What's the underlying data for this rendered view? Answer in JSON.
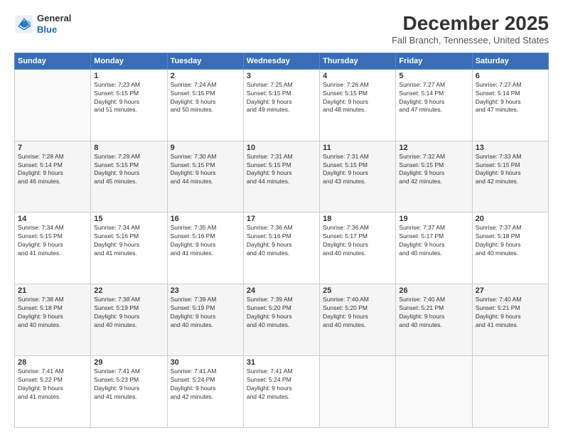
{
  "logo": {
    "line1": "General",
    "line2": "Blue"
  },
  "title": "December 2025",
  "subtitle": "Fall Branch, Tennessee, United States",
  "days_header": [
    "Sunday",
    "Monday",
    "Tuesday",
    "Wednesday",
    "Thursday",
    "Friday",
    "Saturday"
  ],
  "weeks": [
    [
      {
        "num": "",
        "info": ""
      },
      {
        "num": "1",
        "info": "Sunrise: 7:23 AM\nSunset: 5:15 PM\nDaylight: 9 hours\nand 51 minutes."
      },
      {
        "num": "2",
        "info": "Sunrise: 7:24 AM\nSunset: 5:15 PM\nDaylight: 9 hours\nand 50 minutes."
      },
      {
        "num": "3",
        "info": "Sunrise: 7:25 AM\nSunset: 5:15 PM\nDaylight: 9 hours\nand 49 minutes."
      },
      {
        "num": "4",
        "info": "Sunrise: 7:26 AM\nSunset: 5:15 PM\nDaylight: 9 hours\nand 48 minutes."
      },
      {
        "num": "5",
        "info": "Sunrise: 7:27 AM\nSunset: 5:14 PM\nDaylight: 9 hours\nand 47 minutes."
      },
      {
        "num": "6",
        "info": "Sunrise: 7:27 AM\nSunset: 5:14 PM\nDaylight: 9 hours\nand 47 minutes."
      }
    ],
    [
      {
        "num": "7",
        "info": "Sunrise: 7:28 AM\nSunset: 5:14 PM\nDaylight: 9 hours\nand 46 minutes."
      },
      {
        "num": "8",
        "info": "Sunrise: 7:29 AM\nSunset: 5:15 PM\nDaylight: 9 hours\nand 45 minutes."
      },
      {
        "num": "9",
        "info": "Sunrise: 7:30 AM\nSunset: 5:15 PM\nDaylight: 9 hours\nand 44 minutes."
      },
      {
        "num": "10",
        "info": "Sunrise: 7:31 AM\nSunset: 5:15 PM\nDaylight: 9 hours\nand 44 minutes."
      },
      {
        "num": "11",
        "info": "Sunrise: 7:31 AM\nSunset: 5:15 PM\nDaylight: 9 hours\nand 43 minutes."
      },
      {
        "num": "12",
        "info": "Sunrise: 7:32 AM\nSunset: 5:15 PM\nDaylight: 9 hours\nand 42 minutes."
      },
      {
        "num": "13",
        "info": "Sunrise: 7:33 AM\nSunset: 5:15 PM\nDaylight: 9 hours\nand 42 minutes."
      }
    ],
    [
      {
        "num": "14",
        "info": "Sunrise: 7:34 AM\nSunset: 5:15 PM\nDaylight: 9 hours\nand 41 minutes."
      },
      {
        "num": "15",
        "info": "Sunrise: 7:34 AM\nSunset: 5:16 PM\nDaylight: 9 hours\nand 41 minutes."
      },
      {
        "num": "16",
        "info": "Sunrise: 7:35 AM\nSunset: 5:16 PM\nDaylight: 9 hours\nand 41 minutes."
      },
      {
        "num": "17",
        "info": "Sunrise: 7:36 AM\nSunset: 5:16 PM\nDaylight: 9 hours\nand 40 minutes."
      },
      {
        "num": "18",
        "info": "Sunrise: 7:36 AM\nSunset: 5:17 PM\nDaylight: 9 hours\nand 40 minutes."
      },
      {
        "num": "19",
        "info": "Sunrise: 7:37 AM\nSunset: 5:17 PM\nDaylight: 9 hours\nand 40 minutes."
      },
      {
        "num": "20",
        "info": "Sunrise: 7:37 AM\nSunset: 5:18 PM\nDaylight: 9 hours\nand 40 minutes."
      }
    ],
    [
      {
        "num": "21",
        "info": "Sunrise: 7:38 AM\nSunset: 5:18 PM\nDaylight: 9 hours\nand 40 minutes."
      },
      {
        "num": "22",
        "info": "Sunrise: 7:38 AM\nSunset: 5:19 PM\nDaylight: 9 hours\nand 40 minutes."
      },
      {
        "num": "23",
        "info": "Sunrise: 7:39 AM\nSunset: 5:19 PM\nDaylight: 9 hours\nand 40 minutes."
      },
      {
        "num": "24",
        "info": "Sunrise: 7:39 AM\nSunset: 5:20 PM\nDaylight: 9 hours\nand 40 minutes."
      },
      {
        "num": "25",
        "info": "Sunrise: 7:40 AM\nSunset: 5:20 PM\nDaylight: 9 hours\nand 40 minutes."
      },
      {
        "num": "26",
        "info": "Sunrise: 7:40 AM\nSunset: 5:21 PM\nDaylight: 9 hours\nand 40 minutes."
      },
      {
        "num": "27",
        "info": "Sunrise: 7:40 AM\nSunset: 5:21 PM\nDaylight: 9 hours\nand 41 minutes."
      }
    ],
    [
      {
        "num": "28",
        "info": "Sunrise: 7:41 AM\nSunset: 5:22 PM\nDaylight: 9 hours\nand 41 minutes."
      },
      {
        "num": "29",
        "info": "Sunrise: 7:41 AM\nSunset: 5:23 PM\nDaylight: 9 hours\nand 41 minutes."
      },
      {
        "num": "30",
        "info": "Sunrise: 7:41 AM\nSunset: 5:24 PM\nDaylight: 9 hours\nand 42 minutes."
      },
      {
        "num": "31",
        "info": "Sunrise: 7:41 AM\nSunset: 5:24 PM\nDaylight: 9 hours\nand 42 minutes."
      },
      {
        "num": "",
        "info": ""
      },
      {
        "num": "",
        "info": ""
      },
      {
        "num": "",
        "info": ""
      }
    ]
  ]
}
